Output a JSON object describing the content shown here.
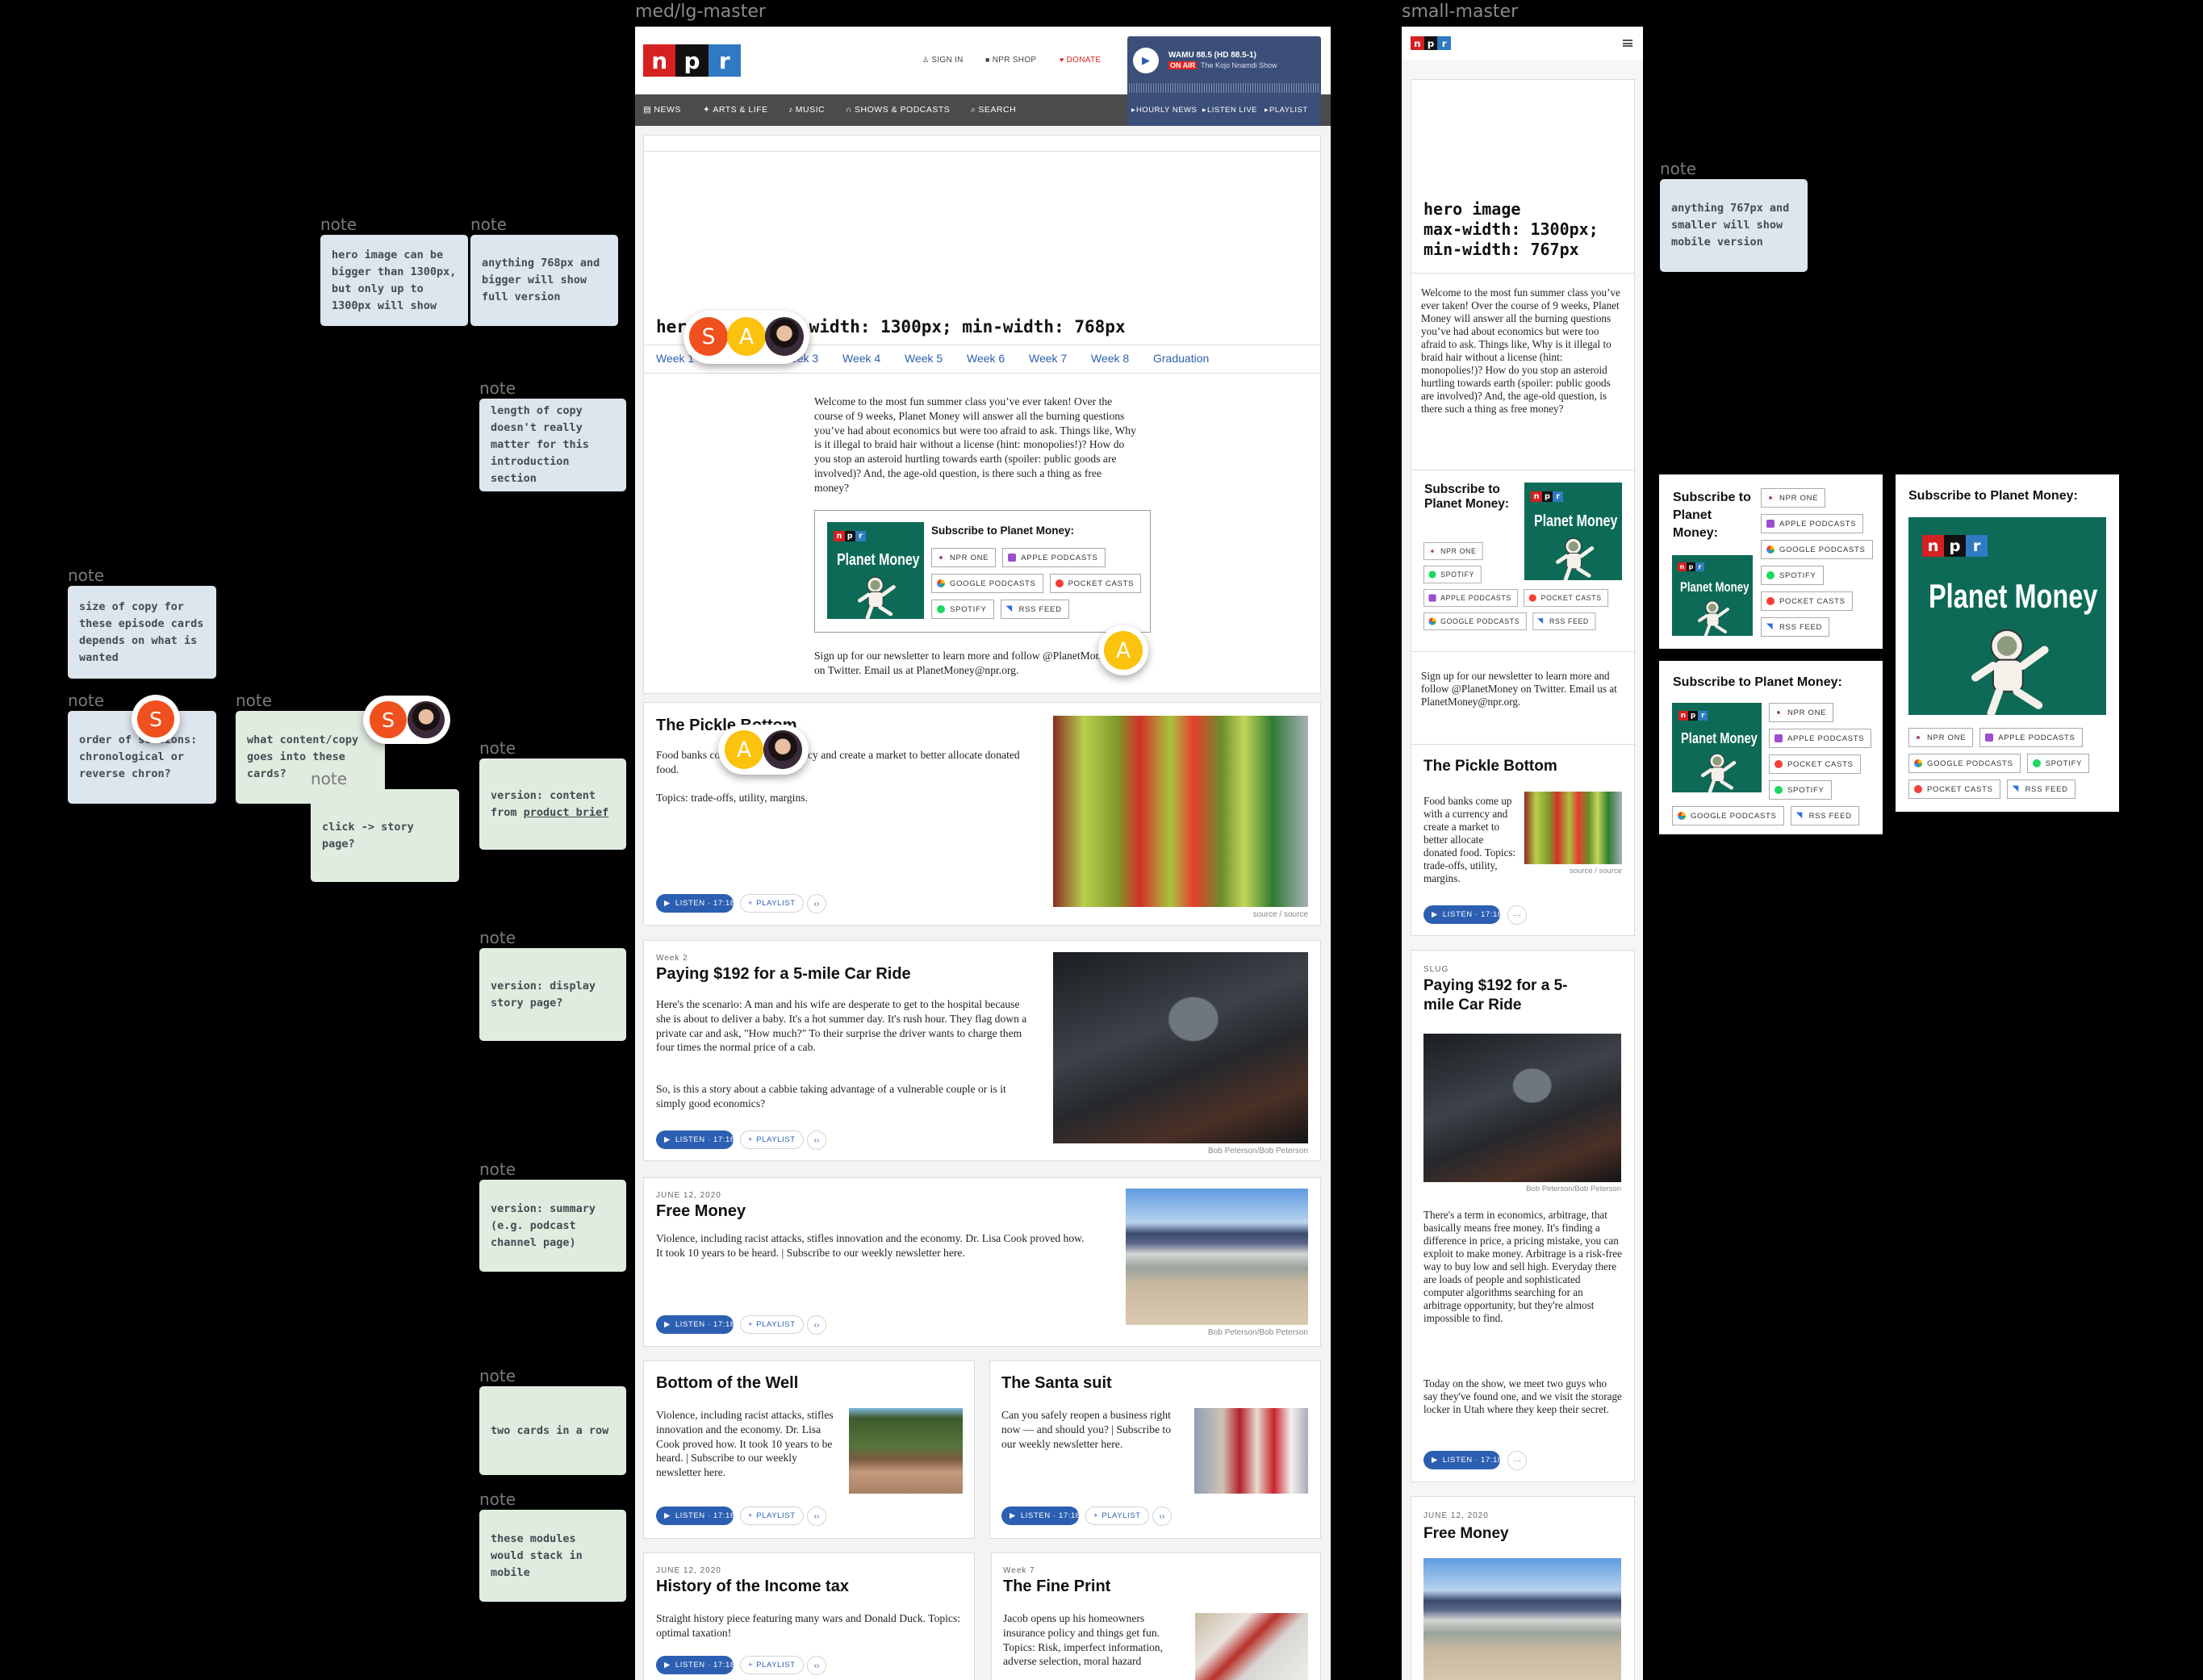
{
  "labels": {
    "med_frame": "med/lg-master",
    "small_frame": "small-master",
    "note": "note"
  },
  "logo": {
    "letters": [
      "n",
      "p",
      "r"
    ],
    "colors": [
      "#d62021",
      "#111111",
      "#2f7ac2"
    ]
  },
  "notes": [
    {
      "color": "blue",
      "text": "hero image can be bigger than 1300px, but only up to 1300px will show"
    },
    {
      "color": "blue",
      "text": "anything 768px and bigger will show full version"
    },
    {
      "color": "blue",
      "text": "length of copy doesn't really matter for this introduction section"
    },
    {
      "color": "blue",
      "text": "size of copy for these episode cards depends on what is wanted"
    },
    {
      "color": "blue",
      "text": "order of sections: chronological or reverse chron?"
    },
    {
      "color": "green",
      "text": "what content/copy goes into these cards?"
    },
    {
      "color": "green",
      "text": "click -> story page?"
    },
    {
      "color": "green",
      "text": "version: content from ",
      "link": "product brief"
    },
    {
      "color": "green",
      "text": "version: display story page?"
    },
    {
      "color": "green",
      "text": "version: summary (e.g. podcast channel page)"
    },
    {
      "color": "green",
      "text": "two cards in a row"
    },
    {
      "color": "green",
      "text": "these modules would stack in mobile"
    },
    {
      "color": "blue",
      "text": "anything 767px and smaller will show mobile version"
    }
  ],
  "collaborators": {
    "s": "S",
    "a": "A"
  },
  "header": {
    "sign_in": "SIGN IN",
    "shop": "NPR SHOP",
    "donate": "DONATE"
  },
  "player": {
    "station": "WAMU 88.5 (HD 88.5-1)",
    "on_air": "ON AIR",
    "show": "The Kojo Nnamdi Show",
    "links": [
      "HOURLY NEWS",
      "LISTEN LIVE",
      "PLAYLIST"
    ],
    "bg": "#3b4f79"
  },
  "nav": [
    "NEWS",
    "ARTS & LIFE",
    "MUSIC",
    "SHOWS & PODCASTS",
    "SEARCH"
  ],
  "hero": {
    "desktop_text": "hero image max-width: 1300px; min-width: 768px",
    "mobile_lines": [
      "hero image",
      "max-width: 1300px;",
      "min-width: 767px"
    ]
  },
  "tabs": [
    "Week 1",
    "Week 2",
    "Week 3",
    "Week 4",
    "Week 5",
    "Week 6",
    "Week 7",
    "Week 8",
    "Graduation"
  ],
  "intro": "Welcome to the most fun summer class you’ve ever taken! Over the course of 9 weeks, Planet Money will answer all the burning questions you’ve had about economics but were too afraid to ask. Things like, Why is it illegal to braid hair without a license (hint: monopolies!)? How do you stop an asteroid hurtling towards earth (spoiler: public goods are involved)? And, the age-old question, is there such a thing as free money?",
  "subscribe": {
    "title": "Subscribe to Planet Money:",
    "art_title": "Planet Money",
    "buttons": [
      {
        "label": "NPR ONE",
        "icon": "npr-one-icon"
      },
      {
        "label": "APPLE PODCASTS",
        "icon": "apple-podcasts-icon"
      },
      {
        "label": "GOOGLE PODCASTS",
        "icon": "google-podcasts-icon"
      },
      {
        "label": "POCKET CASTS",
        "icon": "pocket-casts-icon"
      },
      {
        "label": "SPOTIFY",
        "icon": "spotify-icon"
      },
      {
        "label": "RSS FEED",
        "icon": "rss-icon"
      }
    ]
  },
  "newsletter": "Sign up for our newsletter to learn more and follow @PlanetMoney on Twitter. Email us at PlanetMoney@npr.org.",
  "buttons": {
    "listen": "LISTEN · 17:18",
    "playlist": "PLAYLIST",
    "more": "···",
    "embed": "‹›"
  },
  "cards": [
    {
      "slug": "",
      "title": "The Pickle Bottom",
      "paras": [
        "Food banks come up with a currency and create a market to better allocate donated food.",
        "Topics: trade-offs, utility, margins."
      ],
      "caption": "source / source"
    },
    {
      "slug": "Week 2",
      "title": "Paying $192 for a 5-mile Car Ride",
      "paras": [
        "Here's the scenario: A man and his wife are desperate to get to the hospital because she is about to deliver a baby. It's a hot summer day. It's rush hour. They flag down a private car and ask, \"How much?\" To their surprise the driver wants to charge them four times the normal price of a cab.",
        "So, is this a story about a cabbie taking advantage of a vulnerable couple or is it simply good economics?"
      ],
      "caption": "Bob Peterson/Bob Peterson"
    },
    {
      "slug": "JUNE 12, 2020",
      "title": "Free Money",
      "paras": [
        "Violence, including racist attacks, stifles innovation and the economy. Dr. Lisa Cook proved how. It took 10 years to be heard. | Subscribe to our weekly newsletter here."
      ],
      "caption": "Bob Peterson/Bob Peterson"
    },
    {
      "slug": "",
      "title": "Bottom of the Well",
      "paras": [
        "Violence, including racist attacks, stifles innovation and the economy. Dr. Lisa Cook proved how. It took 10 years to be heard. | Subscribe to our weekly newsletter here."
      ]
    },
    {
      "slug": "",
      "title": "The Santa suit",
      "paras": [
        "Can you safely reopen a business right now — and should you? | Subscribe to our weekly newsletter here."
      ]
    },
    {
      "slug": "JUNE 12, 2020",
      "title": "History of the Income tax",
      "paras": [
        "Straight history piece featuring many wars and Donald Duck. Topics: optimal taxation!"
      ]
    },
    {
      "slug": "Week 7",
      "title": "The Fine Print",
      "paras": [
        "Jacob opens up his homeowners insurance policy and things get fun. Topics: Risk, imperfect information, adverse selection, moral hazard"
      ]
    }
  ],
  "mobile_cards": [
    {
      "slug": "",
      "title": "The Pickle Bottom",
      "paras": [
        "Food banks come up with a currency and create a market to better allocate donated food. Topics: trade-offs, utility, margins."
      ],
      "caption": "source / source"
    },
    {
      "slug": "SLUG",
      "title": "Paying $192 for a 5-mile Car Ride",
      "paras": [
        "There's a term in economics, arbitrage, that basically means free money. It's finding a difference in price, a pricing mistake, you can exploit to make money. Arbitrage is a risk-free way to buy low and sell high. Everyday there are loads of people and sophisticated computer algorithms searching for an arbitrage opportunity, but they're almost impossible to find.",
        "Today on the show, we meet two guys who say they've found one, and we visit the storage locker in Utah where they keep their secret."
      ],
      "caption": "Bob Peterson/Bob Peterson"
    },
    {
      "slug": "JUNE 12, 2020",
      "title": "Free Money",
      "paras": []
    }
  ]
}
